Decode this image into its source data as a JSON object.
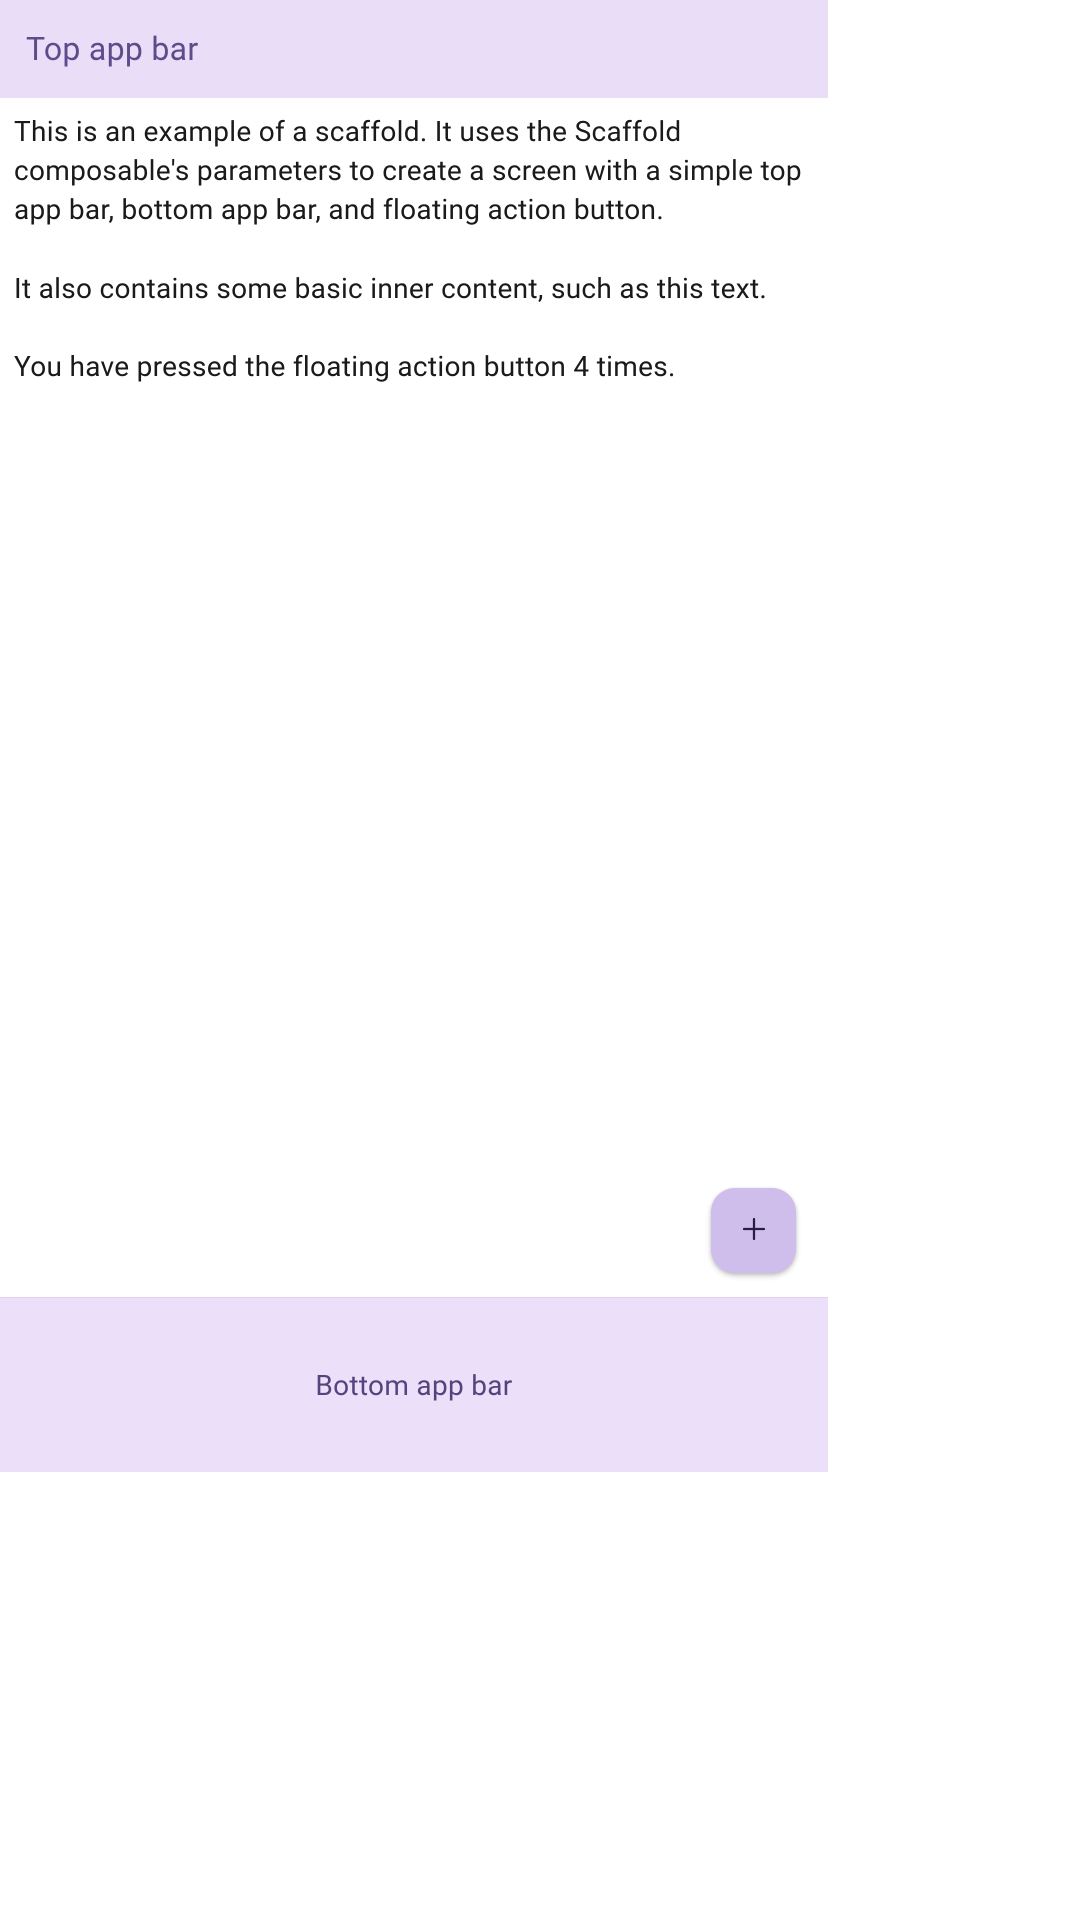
{
  "topBar": {
    "title": "Top app bar"
  },
  "content": {
    "body": "This is an example of a scaffold. It uses the Scaffold composable's parameters to create a screen with a simple top app bar, bottom app bar, and floating action button.\n\nIt also contains some basic inner content, such as this text.\n\nYou have pressed the floating action button 4 times."
  },
  "bottomBar": {
    "label": "Bottom app bar"
  },
  "fab": {
    "iconName": "plus-icon",
    "pressCount": 4
  },
  "colors": {
    "topBarBackground": "#e9ddf8",
    "topBarText": "#5d4b8b",
    "bottomBarBackground": "#ecdff9",
    "bottomBarText": "#54447e",
    "fabBackground": "#cfbdeb",
    "fabIcon": "#2a1d45"
  }
}
